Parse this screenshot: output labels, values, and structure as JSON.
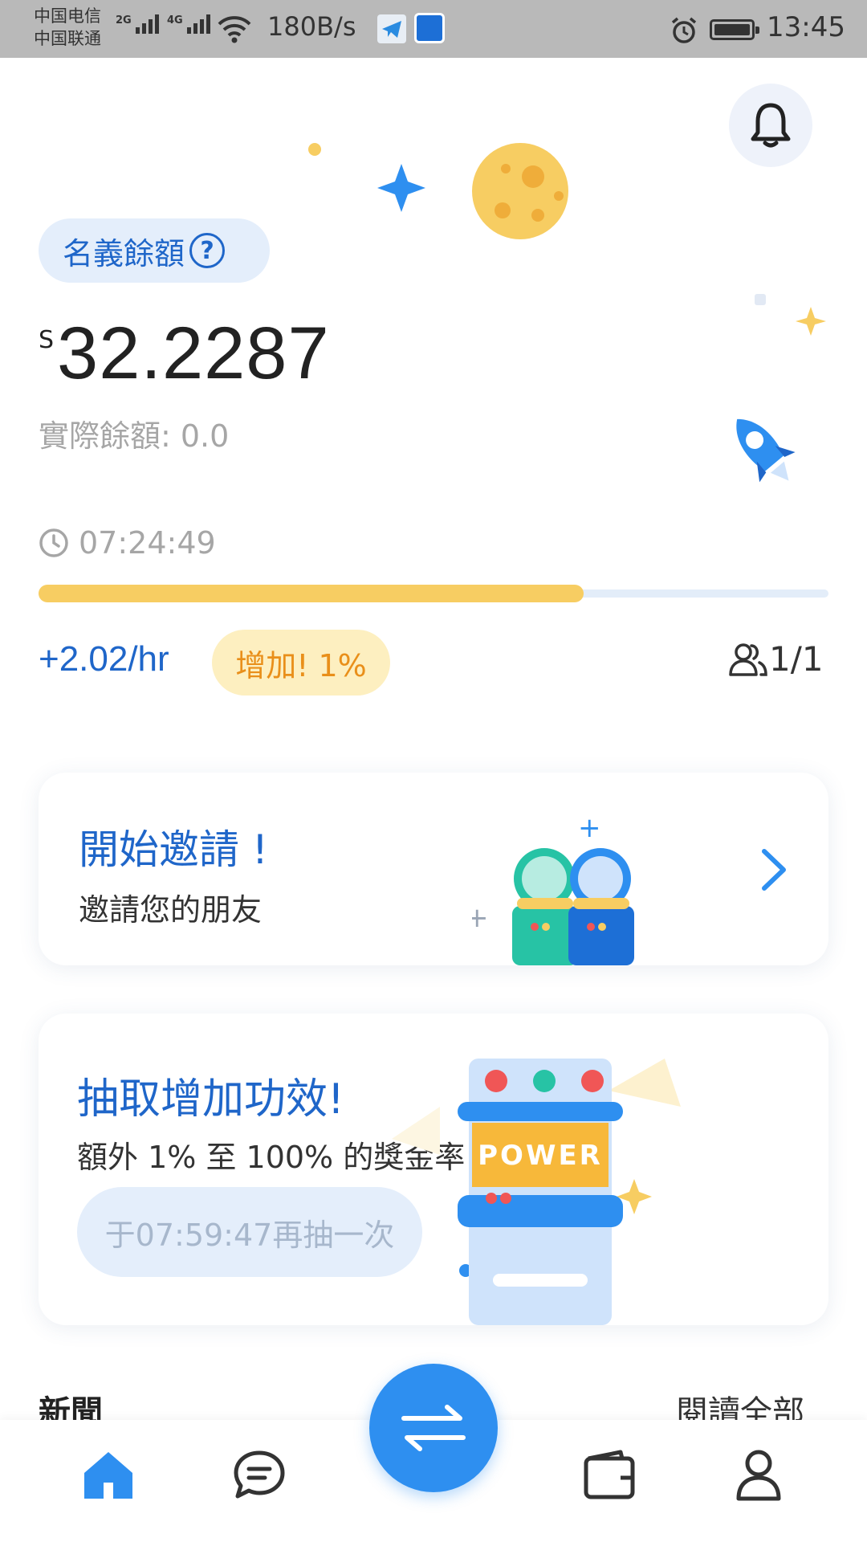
{
  "status_bar": {
    "carrier_1": "中国电信",
    "carrier_2": "中国联通",
    "signal_1_tag": "2G",
    "signal_2_tag": "4G",
    "net_speed": "180B/s",
    "time": "13:45",
    "icons": [
      "signal-icon",
      "wifi-icon",
      "telegram-app-icon",
      "bank-app-icon",
      "alarm-icon",
      "battery-icon"
    ]
  },
  "header": {
    "notification_icon": "bell-icon"
  },
  "balance": {
    "nominal_label": "名義餘額",
    "help_symbol": "?",
    "currency": "S",
    "amount": "32.2287",
    "actual_label": "實際餘額: 0.0"
  },
  "session": {
    "timer": "07:24:49",
    "progress": 0.69,
    "rate": "+2.02/hr",
    "boost": "增加! 1%",
    "members": "1/1"
  },
  "invite_card": {
    "title": "開始邀請 !",
    "subtitle": "邀請您的朋友"
  },
  "power_card": {
    "title": "抽取增加功效!",
    "subtitle": "額外 1% 至 100% 的獎金率",
    "button_label": "于07:59:47再抽一次",
    "machine_label": "POWER"
  },
  "news": {
    "title": "新聞",
    "read_all": "閱讀全部"
  },
  "tab_bar": {
    "tabs": [
      "home-icon",
      "chat-icon",
      "swap-icon",
      "wallet-icon",
      "profile-icon"
    ]
  },
  "colors": {
    "primary": "#1f66c9",
    "accent": "#2e8ff0",
    "progress": "#f7cd62",
    "boost_text": "#e98f1a"
  }
}
